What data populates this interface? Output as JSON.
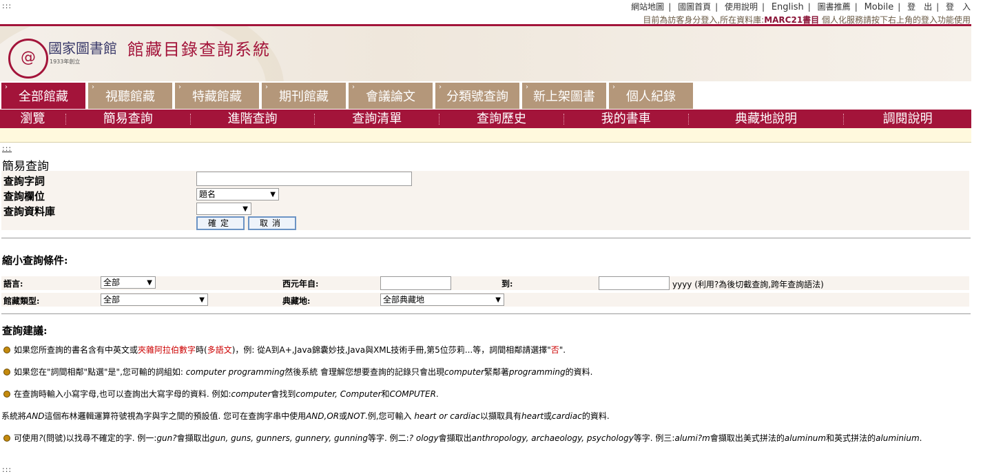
{
  "skip_link": ":::",
  "top_nav": {
    "items": [
      "網站地圖",
      "國圖首頁",
      "使用說明",
      "English",
      "圖書推薦",
      "Mobile",
      "登　出",
      "登　入"
    ],
    "separator": "|"
  },
  "login_message": {
    "prefix": "目前為訪客身分登入,所在資料庫:",
    "database": "MARC21書目",
    "suffix": " 個人化服務請按下右上角的登入功能使用"
  },
  "banner": {
    "logo_mark": "@",
    "org_name": "國家圖書館",
    "year": "1933年創立",
    "system_title": "館藏目錄查詢系統"
  },
  "tabs": [
    "全部館藏",
    "視聽館藏",
    "特藏館藏",
    "期刊館藏",
    "會議論文",
    "分類號查詢",
    "新上架圖書",
    "個人紀錄"
  ],
  "tab_arrow": "›",
  "subnav": [
    "瀏覽",
    "簡易查詢",
    "進階查詢",
    "查詢清單",
    "查詢歷史",
    "我的書車",
    "典藏地說明",
    "調閱說明"
  ],
  "page_title": "簡易查詢",
  "search_form": {
    "term_label": "查詢字詞",
    "term_value": "",
    "field_label": "查詢欄位",
    "field_value": "題名",
    "db_label": "查詢資料庫",
    "db_value": "",
    "ok_label": "確定",
    "cancel_label": "取消"
  },
  "narrow": {
    "title": "縮小查詢條件:",
    "lang_label": "語言:",
    "lang_value": "全部",
    "year_from_label": "西元年自:",
    "year_from_value": "",
    "year_to_label": "到:",
    "year_to_value": "",
    "year_hint": "yyyy (利用?為後切截查詢,跨年查詢語法)",
    "type_label": "館藏類型:",
    "type_value": "全部",
    "location_label": "典藏地:",
    "location_value": "全部典藏地"
  },
  "tips": {
    "title": "查詢建議:",
    "t1": {
      "a": "如果您所查詢的書名含有中英文或",
      "b": "夾雜阿拉伯數字",
      "c": "時(",
      "d": "多語文",
      "e": ")，例: 從A到A+,Java錦囊妙技,Java與XML技術手冊,第5位莎莉...等，詞間相鄰請選擇\"",
      "f": "否",
      "g": "\"."
    },
    "t2": {
      "a": "如果您在\"詞間相鄰\"點選\"是\",您可輸的詞組如: ",
      "b": "computer programming",
      "c": "然後系統 會理解您想要查詢的記錄只會出現",
      "d": "computer",
      "e": "緊鄰著",
      "f": "programming",
      "g": "的資料."
    },
    "t3": {
      "a": "在查詢時輸入小寫字母,也可以查詢出大寫字母的資料. 例如:",
      "b": "computer",
      "c": "會找到",
      "d": "computer, Computer",
      "e": "和",
      "f": "COMPUTER",
      "g": "."
    },
    "t4": {
      "a": "系統將",
      "b": "AND",
      "c": "這個布林邏輯運算符號視為字與字之間的預設值. 您可在查詢字串中使用",
      "d": "AND,OR",
      "e": "或",
      "f": "NOT",
      "g": ".例,您可輸入 ",
      "h": "heart or cardiac",
      "i": "以擷取具有",
      "j": "heart",
      "k": "或",
      "l": "cardiac",
      "m": "的資料."
    },
    "t5": {
      "a": "可使用",
      "b": "?",
      "c": "(問號)以找尋不確定的字. 例一:",
      "d": "gun?",
      "e": "會擷取出",
      "f": "gun, guns, gunners, gunnery, gunning",
      "g": "等字. 例二:",
      "h": "? ology",
      "i": "會擷取出",
      "j": "anthropology, archaeology, psychology",
      "k": "等字. 例三:",
      "l": "alumi?m",
      "m": "會擷取出美式拼法的",
      "n": "aluminum",
      "o": "和英式拼法的",
      "p": "aluminium",
      "q": "."
    }
  },
  "bottom_skip_link": ":::"
}
